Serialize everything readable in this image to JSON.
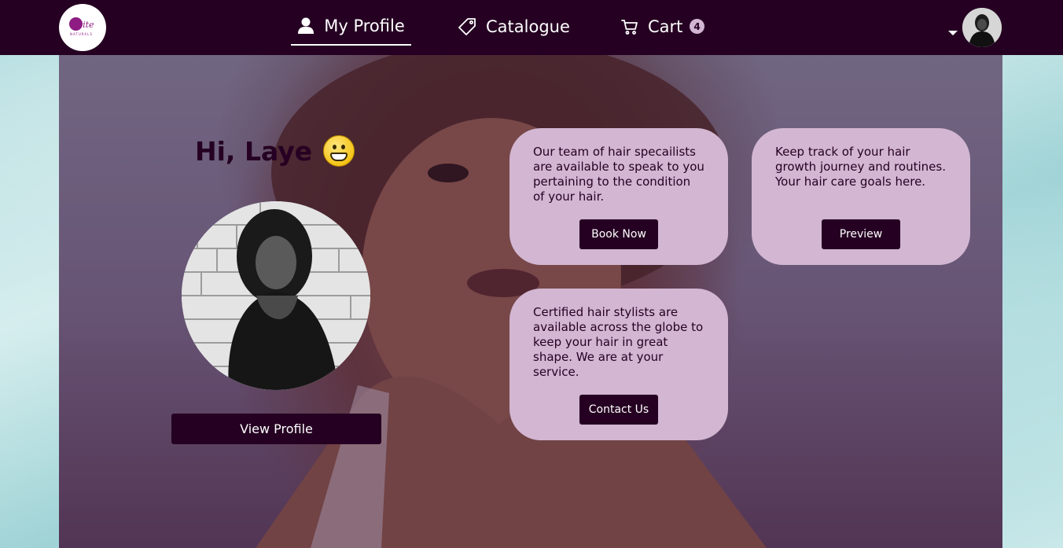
{
  "brand": {
    "logo_script": "Bite",
    "logo_sub": "NATURALS"
  },
  "nav": {
    "profile_label": "My Profile",
    "catalogue_label": "Catalogue",
    "cart_label": "Cart",
    "cart_count": "4"
  },
  "hero": {
    "greeting": "Hi, Laye",
    "view_profile_label": "View Profile"
  },
  "cards": [
    {
      "text": "Our team of hair specailists are available to speak to you pertaining to the condition of your hair.",
      "button": "Book Now"
    },
    {
      "text": "Keep track of your hair growth journey and routines. Your hair care goals here.",
      "button": "Preview"
    },
    {
      "text": "Certified hair stylists are available across the globe to keep your hair in great shape. We are at your service.",
      "button": "Contact Us"
    }
  ],
  "colors": {
    "nav_bg": "#250022",
    "card_bg": "#d2b6d2",
    "button_bg": "#250022",
    "logo_accent": "#8e1c83"
  },
  "icons": [
    "user-icon",
    "tag-icon",
    "cart-icon",
    "dropdown-caret-icon",
    "grinning-emoji-icon"
  ]
}
